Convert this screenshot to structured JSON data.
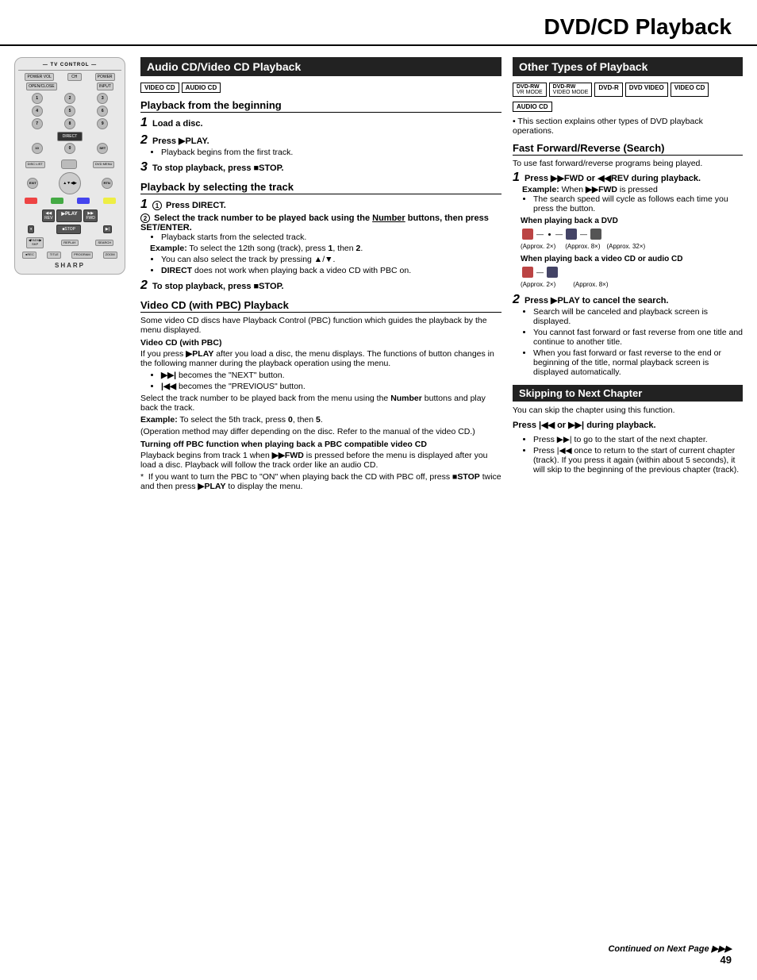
{
  "page": {
    "title": "DVD/CD Playback",
    "page_number": "49",
    "continued": "Continued on Next Page ▶▶▶"
  },
  "audio_cd_section": {
    "header": "Audio CD/Video CD Playback",
    "badges": [
      "VIDEO CD",
      "AUDIO CD"
    ],
    "playback_from_beginning": {
      "header": "Playback from the beginning",
      "steps": [
        {
          "num": "1",
          "text": "Load a disc."
        },
        {
          "num": "2",
          "text": "Press ▶PLAY.",
          "sub": [
            "Playback begins from the first track."
          ]
        },
        {
          "num": "3",
          "text": "To stop playback, press ■STOP."
        }
      ]
    },
    "playback_by_track": {
      "header": "Playback by selecting the track",
      "steps": [
        {
          "num": "1",
          "items": [
            {
              "circle": "1",
              "text": "Press DIRECT."
            },
            {
              "circle": "2",
              "text": "Select the track number to be played back using the Number buttons, then press SET/ENTER."
            }
          ],
          "sub": [
            "Playback starts from the selected track.",
            "Example: To select the 12th song (track), press 1, then 2.",
            "You can also select the track by pressing ▲/▼.",
            "DIRECT does not work when playing back a video CD with PBC on."
          ]
        },
        {
          "num": "2",
          "text": "To stop playback, press ■STOP."
        }
      ]
    },
    "video_cd_pbc": {
      "header": "Video CD (with PBC) Playback",
      "intro": "Some video CD discs have Playback Control (PBC) function which guides the playback by the menu displayed.",
      "sub_heading": "Video CD (with PBC)",
      "pbc_text": "If you press ▶PLAY after you load a disc, the menu displays. The functions of button changes in the following manner during the playback operation using the menu.",
      "pbc_items": [
        "▶▶| becomes the \"NEXT\" button.",
        "|◀◀ becomes the \"PREVIOUS\" button."
      ],
      "track_text": "Select the track number to be played back from the menu using the Number buttons and play back the track.",
      "example_text": "Example: To select the 5th track, press 0, then 5.",
      "note_text": "(Operation method may differ depending on the disc. Refer to the manual of the video CD.)",
      "turning_off_header": "Turning off PBC function when playing back a PBC compatible video CD",
      "turning_off_text": "Playback begins from track 1 when ▶▶FWD is pressed before the menu is displayed after you load a disc. Playback will follow the track order like an audio CD.",
      "asterisk_text": "* If you want to turn the PBC to \"ON\" when playing back the CD with PBC off, press ■STOP twice and then press ▶PLAY to display the menu."
    }
  },
  "other_types_section": {
    "header": "Other Types of Playback",
    "badges": [
      "DVD-RW VR MODE",
      "DVD-RW VIDEO MODE",
      "DVD-R",
      "DVD VIDEO",
      "VIDEO CD",
      "AUDIO CD"
    ],
    "intro": "This section explains other types of DVD playback operations.",
    "fast_forward": {
      "header": "Fast Forward/Reverse (Search)",
      "intro": "To use fast forward/reverse programs being played.",
      "steps": [
        {
          "num": "1",
          "text": "Press ▶▶FWD or ◀◀REV during playback.",
          "example_label": "Example:",
          "example_text": "When ▶▶FWD is pressed",
          "note": "The search speed will cycle as follows each time you press the button.",
          "dvd_label": "When playing back a DVD",
          "dvd_speeds": [
            "(Approx. 2×)",
            "(Approx. 8×)",
            "(Approx. 32×)"
          ],
          "cd_label": "When playing back a video CD or audio CD",
          "cd_speeds": [
            "(Approx. 2×)",
            "(Approx. 8×)"
          ]
        },
        {
          "num": "2",
          "text": "Press ▶PLAY to cancel the search.",
          "sub": [
            "Search will be canceled and playback screen is displayed.",
            "You cannot fast forward or fast reverse from one title and continue to another title.",
            "When you fast forward or fast reverse to the end or beginning of the title, normal playback screen is displayed automatically."
          ]
        }
      ]
    },
    "skipping": {
      "header": "Skipping to Next Chapter",
      "intro": "You can skip the chapter using this function.",
      "press_text": "Press |◀◀ or ▶▶| during playback.",
      "items": [
        "Press ▶▶| to go to the start of the next chapter.",
        "Press |◀◀ once to return to the start of current chapter (track). If you press it again (within about 5 seconds), it will skip to the beginning of the previous chapter (track)."
      ]
    }
  }
}
